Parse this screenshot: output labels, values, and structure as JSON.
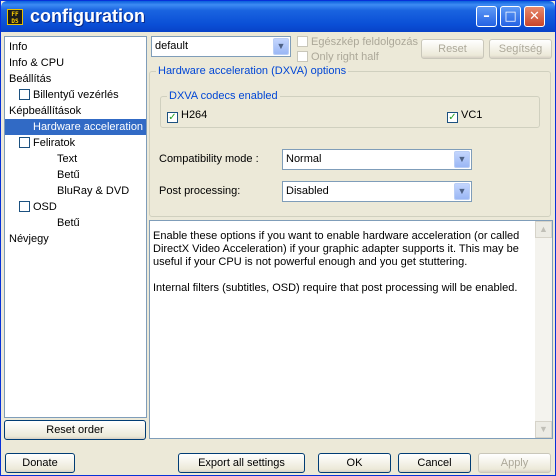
{
  "window": {
    "title": "configuration",
    "icon_text": "FFDSHOW",
    "minimize_icon": "minimize-icon",
    "maximize_icon": "maximize-icon",
    "close_icon": "close-icon"
  },
  "tree": {
    "items": [
      {
        "label": "Info",
        "indent": 0,
        "checkbox": false,
        "selected": false
      },
      {
        "label": "Info & CPU",
        "indent": 0,
        "checkbox": false,
        "selected": false
      },
      {
        "label": "Beállítás",
        "indent": 0,
        "checkbox": false,
        "selected": false
      },
      {
        "label": "Billentyű vezérlés",
        "indent": 1,
        "checkbox": true,
        "selected": false
      },
      {
        "label": "Képbeállítások",
        "indent": 0,
        "checkbox": false,
        "selected": false
      },
      {
        "label": "Hardware acceleration",
        "indent": 1,
        "checkbox": false,
        "selected": true
      },
      {
        "label": "Feliratok",
        "indent": 1,
        "checkbox": true,
        "selected": false
      },
      {
        "label": "Text",
        "indent": 2,
        "checkbox": false,
        "selected": false
      },
      {
        "label": "Betű",
        "indent": 2,
        "checkbox": false,
        "selected": false
      },
      {
        "label": "BluRay & DVD",
        "indent": 2,
        "checkbox": false,
        "selected": false
      },
      {
        "label": "OSD",
        "indent": 1,
        "checkbox": true,
        "selected": false
      },
      {
        "label": "Betű",
        "indent": 2,
        "checkbox": false,
        "selected": false
      },
      {
        "label": "Névjegy",
        "indent": 0,
        "checkbox": false,
        "selected": false
      }
    ],
    "reset_order_label": "Reset order"
  },
  "toolbar": {
    "preset_value": "default",
    "fullimage_label": "Egészkép feldolgozás",
    "righthalf_label": "Only right half",
    "reset_label": "Reset",
    "help_label": "Segítség"
  },
  "hw": {
    "group_title": "Hardware acceleration (DXVA) options",
    "codecs_title": "DXVA codecs enabled",
    "h264_label": "H264",
    "h264_checked": true,
    "vc1_label": "VC1",
    "vc1_checked": true,
    "compat_label": "Compatibility mode :",
    "compat_value": "Normal",
    "post_label": "Post processing:",
    "post_value": "Disabled"
  },
  "description": {
    "para1": "Enable these options if you want to enable hardware acceleration (or called DirectX Video Acceleration) if your graphic adapter supports it. This may be useful if your CPU is not powerful enough and you get stuttering.",
    "para2": "Internal filters (subtitles, OSD) require that post processing will be enabled."
  },
  "footer": {
    "donate_label": "Donate",
    "export_label": "Export all settings",
    "ok_label": "OK",
    "cancel_label": "Cancel",
    "apply_label": "Apply"
  },
  "colors": {
    "selection": "#316ac5",
    "group_label": "#0046d5",
    "titlebar": "#0a4fd6"
  }
}
